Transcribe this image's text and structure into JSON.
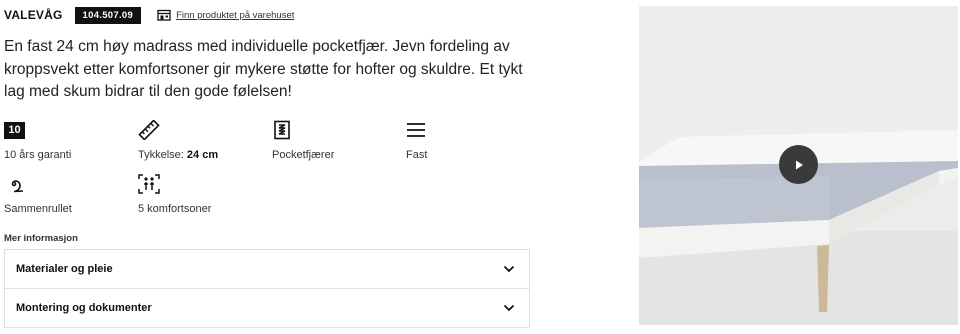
{
  "product": {
    "name": "VALEVÅG",
    "article_number": "104.507.09",
    "store_link_label": "Finn produktet på varehuset"
  },
  "description": "En fast 24 cm høy madrass med individuelle pocketfjær. Jevn fordeling av kroppsvekt etter komfortsoner gir mykere støtte for hofter og skuldre. Et tykt lag med skum bidrar til den gode følelsen!",
  "features": [
    {
      "icon": "warranty-10-icon",
      "badge": "10",
      "label": "10 års garanti"
    },
    {
      "icon": "ruler-icon",
      "label": "Tykkelse:",
      "value": "24 cm"
    },
    {
      "icon": "pocket-spring-icon",
      "label": "Pocketfjærer"
    },
    {
      "icon": "firmness-lines-icon",
      "label": "Fast"
    },
    {
      "icon": "rolled-mattress-icon",
      "label": "Sammenrullet"
    },
    {
      "icon": "comfort-zones-icon",
      "label": "5 komfortsoner"
    }
  ],
  "more_info": {
    "title": "Mer informasjon",
    "sections": [
      {
        "label": "Materialer og pleie",
        "icon": "chevron-down-icon"
      },
      {
        "label": "Montering og dokumenter",
        "icon": "chevron-down-icon"
      }
    ]
  },
  "media": {
    "type": "video",
    "play_icon": "play-icon",
    "colors": {
      "background": "#ededed",
      "mattress_side": "#b9bfcc",
      "bed_base": "#f2f2f0",
      "leg": "#cdb89a",
      "play_button": "#3a3a3a"
    }
  }
}
